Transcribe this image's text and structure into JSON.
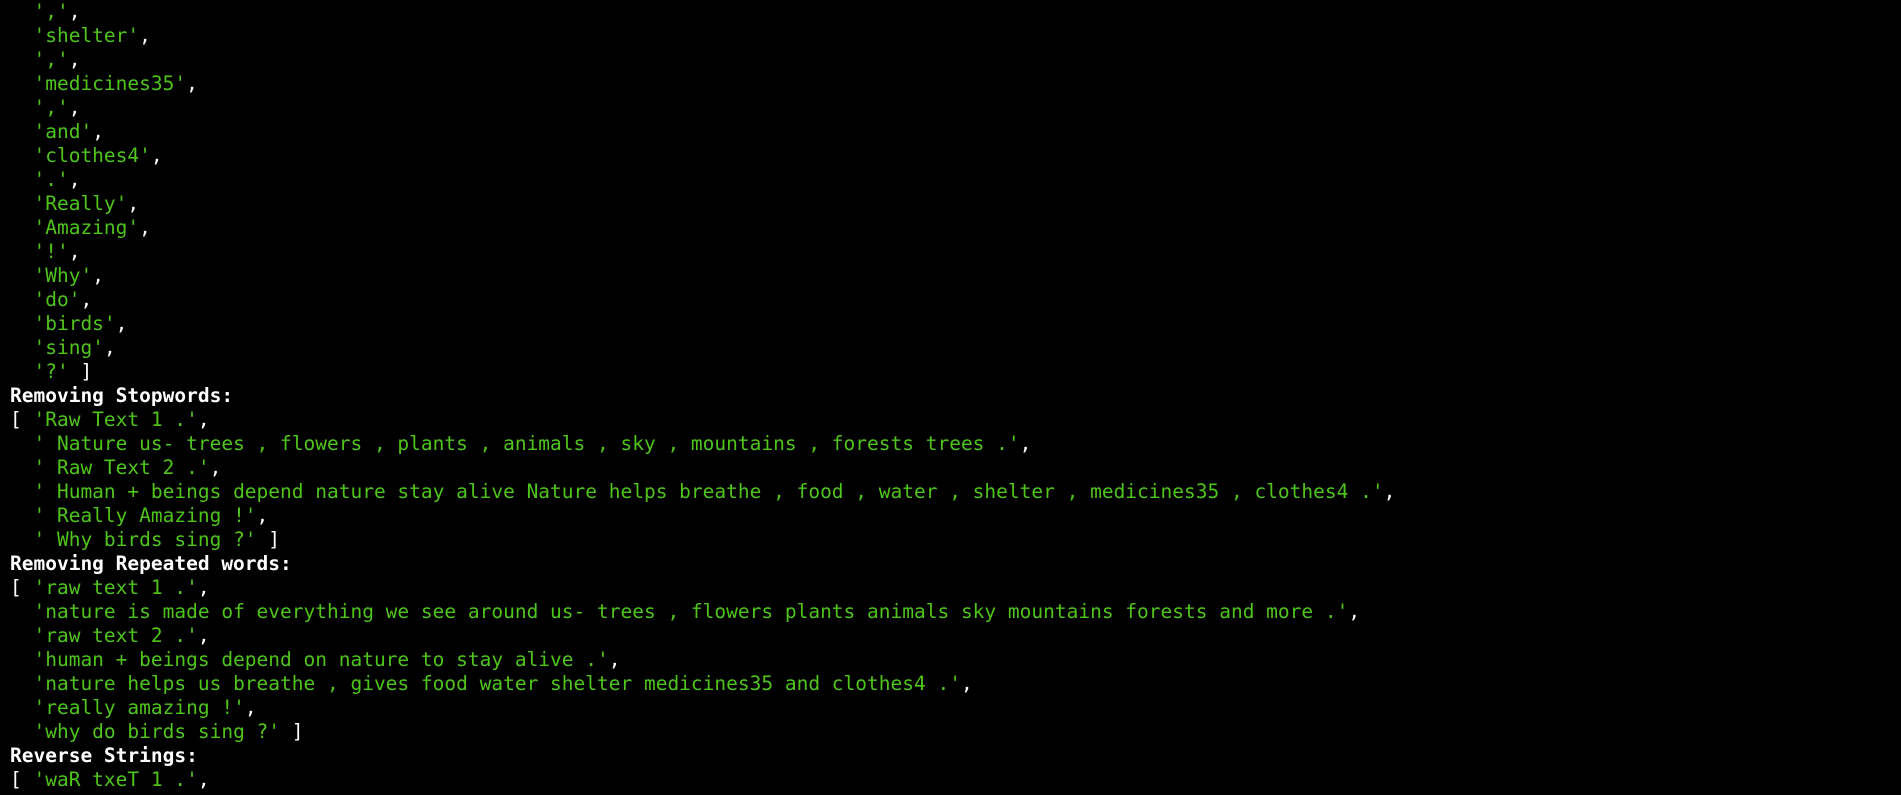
{
  "lines": [
    {
      "kind": "item",
      "prefix": "  ",
      "text": "','",
      "suffix": ","
    },
    {
      "kind": "item",
      "prefix": "  ",
      "text": "'shelter'",
      "suffix": ","
    },
    {
      "kind": "item",
      "prefix": "  ",
      "text": "','",
      "suffix": ","
    },
    {
      "kind": "item",
      "prefix": "  ",
      "text": "'medicines35'",
      "suffix": ","
    },
    {
      "kind": "item",
      "prefix": "  ",
      "text": "','",
      "suffix": ","
    },
    {
      "kind": "item",
      "prefix": "  ",
      "text": "'and'",
      "suffix": ","
    },
    {
      "kind": "item",
      "prefix": "  ",
      "text": "'clothes4'",
      "suffix": ","
    },
    {
      "kind": "item",
      "prefix": "  ",
      "text": "'.'",
      "suffix": ","
    },
    {
      "kind": "item",
      "prefix": "  ",
      "text": "'Really'",
      "suffix": ","
    },
    {
      "kind": "item",
      "prefix": "  ",
      "text": "'Amazing'",
      "suffix": ","
    },
    {
      "kind": "item",
      "prefix": "  ",
      "text": "'!'",
      "suffix": ","
    },
    {
      "kind": "item",
      "prefix": "  ",
      "text": "'Why'",
      "suffix": ","
    },
    {
      "kind": "item",
      "prefix": "  ",
      "text": "'do'",
      "suffix": ","
    },
    {
      "kind": "item",
      "prefix": "  ",
      "text": "'birds'",
      "suffix": ","
    },
    {
      "kind": "item",
      "prefix": "  ",
      "text": "'sing'",
      "suffix": ","
    },
    {
      "kind": "item",
      "prefix": "  ",
      "text": "'?'",
      "suffix": " ]"
    },
    {
      "kind": "header",
      "text": "Removing Stopwords:"
    },
    {
      "kind": "item",
      "prefix": "[ ",
      "text": "'Raw Text 1 .'",
      "suffix": ","
    },
    {
      "kind": "item",
      "prefix": "  ",
      "text": "' Nature us- trees , flowers , plants , animals , sky , mountains , forests trees .'",
      "suffix": ","
    },
    {
      "kind": "item",
      "prefix": "  ",
      "text": "' Raw Text 2 .'",
      "suffix": ","
    },
    {
      "kind": "item",
      "prefix": "  ",
      "text": "' Human + beings depend nature stay alive Nature helps breathe , food , water , shelter , medicines35 , clothes4 .'",
      "suffix": ","
    },
    {
      "kind": "item",
      "prefix": "  ",
      "text": "' Really Amazing !'",
      "suffix": ","
    },
    {
      "kind": "item",
      "prefix": "  ",
      "text": "' Why birds sing ?'",
      "suffix": " ]"
    },
    {
      "kind": "header",
      "text": "Removing Repeated words:"
    },
    {
      "kind": "item",
      "prefix": "[ ",
      "text": "'raw text 1 .'",
      "suffix": ","
    },
    {
      "kind": "item",
      "prefix": "  ",
      "text": "'nature is made of everything we see around us- trees , flowers plants animals sky mountains forests and more .'",
      "suffix": ","
    },
    {
      "kind": "item",
      "prefix": "  ",
      "text": "'raw text 2 .'",
      "suffix": ","
    },
    {
      "kind": "item",
      "prefix": "  ",
      "text": "'human + beings depend on nature to stay alive .'",
      "suffix": ","
    },
    {
      "kind": "item",
      "prefix": "  ",
      "text": "'nature helps us breathe , gives food water shelter medicines35 and clothes4 .'",
      "suffix": ","
    },
    {
      "kind": "item",
      "prefix": "  ",
      "text": "'really amazing !'",
      "suffix": ","
    },
    {
      "kind": "item",
      "prefix": "  ",
      "text": "'why do birds sing ?'",
      "suffix": " ]"
    },
    {
      "kind": "header",
      "text": "Reverse Strings:"
    },
    {
      "kind": "item",
      "prefix": "[ ",
      "text": "'waR txeT 1 .'",
      "suffix": ","
    }
  ],
  "colors": {
    "background": "#000000",
    "string": "#4fc41a",
    "punctuation": "#ffffff"
  }
}
